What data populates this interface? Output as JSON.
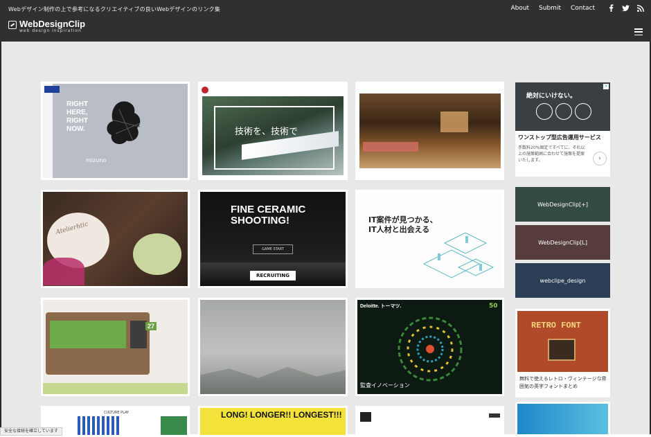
{
  "header": {
    "tagline": "Webデザイン制作の上で参考になるクリエイティブの良いWebデザインのリンク集",
    "logo_name": "WebDesignClip",
    "logo_sub": "web design inspiration",
    "nav": [
      "About",
      "Submit",
      "Contact"
    ]
  },
  "cards": [
    {
      "name": "mizuno",
      "headline": "RIGHT\nHERE,\nRIGHT\nNOW.",
      "brand": "mizuno"
    },
    {
      "name": "jr-tech",
      "headline": "技術を、技術で"
    },
    {
      "name": "yakiniku",
      "headline": ""
    },
    {
      "name": "atelier",
      "headline": "Atelierhtic"
    },
    {
      "name": "fine-ceramic",
      "headline": "FINE CERAMIC\nSHOOTING!",
      "button": "GAME START",
      "banner": "RECRUITING"
    },
    {
      "name": "it-job",
      "headline": "IT案件が見つかる、\nIT人材と出会える"
    },
    {
      "name": "grow",
      "headline": "27"
    },
    {
      "name": "misty",
      "headline": ""
    },
    {
      "name": "deloitte",
      "brand": "Deloitte. トーマツ.",
      "headline": "監査イノベーション",
      "badge": "50"
    },
    {
      "name": "culture",
      "headline": "CULTURE PLAY"
    },
    {
      "name": "longer",
      "headline": "LONG! LONGER!! LONGEST!!!"
    },
    {
      "name": "corp-site",
      "headline": ""
    }
  ],
  "sidebar": {
    "ad_headline": "絶対にいけない。",
    "ad_title": "ワンストップ型広告運用サービス",
    "ad_body": "手数料20%固定ですべてに、それ以上の施策範囲に合わせて施策を提案いたします。",
    "btn1": "WebDesignClip[+]",
    "btn2": "WebDesignClip[L]",
    "btn3": "webclipe_design",
    "retro_title": "RETRO FONT",
    "retro_caption": "無料で使えるレトロ・ヴィンテージな雰囲気の英字フォントまとめ"
  },
  "status_text": "安全な接続を確立しています"
}
